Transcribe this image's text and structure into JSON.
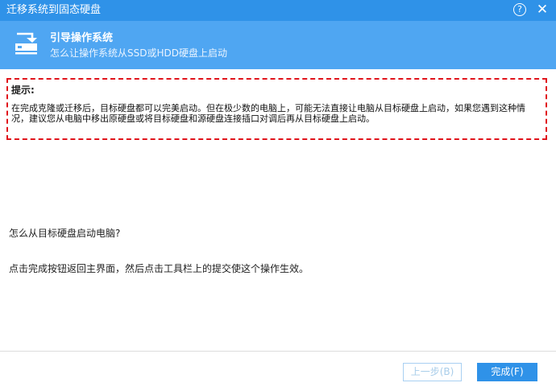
{
  "window": {
    "title": "迁移系统到固态硬盘",
    "help_label": "?",
    "close_label": "✕"
  },
  "banner": {
    "icon": "drive-transfer-icon",
    "title": "引导操作系统",
    "subtitle": "怎么让操作系统从SSD或HDD硬盘上启动"
  },
  "tip": {
    "title": "提示:",
    "body": "在完成克隆或迁移后，目标硬盘都可以完美启动。但在极少数的电脑上，可能无法直接让电脑从目标硬盘上启动，如果您遇到这种情况，建议您从电脑中移出原硬盘或将目标硬盘和源硬盘连接插口对调后再从目标硬盘上启动。"
  },
  "content": {
    "question": "怎么从目标硬盘启动电脑?",
    "instruction": "点击完成按钮返回主界面，然后点击工具栏上的提交使这个操作生效。"
  },
  "footer": {
    "prev_label": "上一步(B)",
    "finish_label": "完成(F)"
  },
  "colors": {
    "titlebar": "#2f92e8",
    "banner": "#4fa6f2",
    "tip_border": "#e0141c",
    "disabled_text": "#a8cdea"
  }
}
